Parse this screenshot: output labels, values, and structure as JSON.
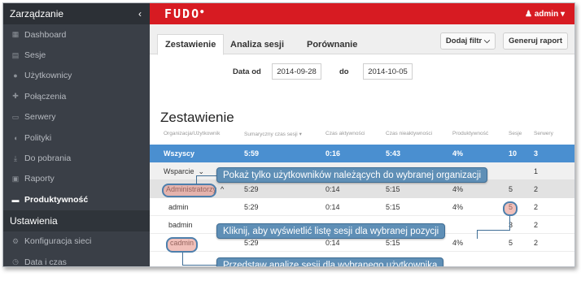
{
  "sidebar": {
    "header": "Zarządzanie",
    "collapse_icon": "chevron-left-icon",
    "items": [
      {
        "label": "Dashboard",
        "icon": "dashboard-icon",
        "glyph": "▦"
      },
      {
        "label": "Sesje",
        "icon": "film-icon",
        "glyph": "▤"
      },
      {
        "label": "Użytkownicy",
        "icon": "users-icon",
        "glyph": "●"
      },
      {
        "label": "Połączenia",
        "icon": "connections-icon",
        "glyph": "✚"
      },
      {
        "label": "Serwery",
        "icon": "server-icon",
        "glyph": "▭"
      },
      {
        "label": "Polityki",
        "icon": "shield-icon",
        "glyph": "◖"
      },
      {
        "label": "Do pobrania",
        "icon": "download-icon",
        "glyph": "⤓"
      },
      {
        "label": "Raporty",
        "icon": "print-icon",
        "glyph": "▣"
      },
      {
        "label": "Produktywność",
        "icon": "bar-chart-icon",
        "glyph": "▬"
      }
    ],
    "section2": "Ustawienia",
    "items2": [
      {
        "label": "Konfiguracja sieci",
        "icon": "cogs-icon",
        "glyph": "⚙"
      },
      {
        "label": "Data i czas",
        "icon": "clock-icon",
        "glyph": "◷"
      }
    ]
  },
  "topbar": {
    "logo": "FUDO",
    "user": "admin",
    "user_caret": "▾",
    "user_icon": "user-icon"
  },
  "tabs": [
    "Zestawienie",
    "Analiza sesji",
    "Porównanie"
  ],
  "buttons": {
    "filter": "Dodaj filtr",
    "filter_caret": "⌵",
    "report": "Generuj raport"
  },
  "dates": {
    "from_label": "Data od",
    "from": "2014-09-28",
    "to_label": "do",
    "to": "2014-10-05"
  },
  "section_title": "Zestawienie",
  "table": {
    "headers": [
      "Organizacja/Użytkownik",
      "Sumaryczny czas sesji",
      "Czas aktywności",
      "Czas nieaktywności",
      "Produktywność",
      "Sesje",
      "Serwery"
    ],
    "sort_icon": "▾",
    "rows": [
      {
        "name": "Wszyscy",
        "total": "5:59",
        "active": "0:16",
        "inactive": "5:43",
        "prod": "4%",
        "sessions": "10",
        "servers": "3"
      },
      {
        "name": "Wsparcie",
        "caret": "⌄",
        "total": "",
        "active": "",
        "inactive": "",
        "prod": "",
        "sessions": "",
        "servers": "1"
      },
      {
        "name": "Administratorzy",
        "caret": "^",
        "total": "5:29",
        "active": "0:14",
        "inactive": "5:15",
        "prod": "4%",
        "sessions": "5",
        "servers": "2"
      },
      {
        "name": "admin",
        "total": "5:29",
        "active": "0:14",
        "inactive": "5:15",
        "prod": "4%",
        "sessions": "5",
        "servers": "2"
      },
      {
        "name": "badmin",
        "total": "",
        "active": "",
        "inactive": "",
        "prod": "",
        "sessions": "3",
        "servers": "2"
      },
      {
        "name": "cadmin",
        "total": "5:29",
        "active": "0:14",
        "inactive": "5:15",
        "prod": "4%",
        "sessions": "5",
        "servers": "2"
      }
    ]
  },
  "callouts": {
    "org": "Pokaż tylko użytkowników należących do wybranej organizacji",
    "sessions": "Kliknij, aby wyświetlić listę sesji dla wybranej pozycji",
    "user": "Przedstaw analizę sesji dla wybranego użytkownika"
  },
  "colors": {
    "brand_red": "#d71b22",
    "sidebar": "#3a3f47",
    "selected_row": "#4a8fd0",
    "callout": "#5f8fb6"
  }
}
